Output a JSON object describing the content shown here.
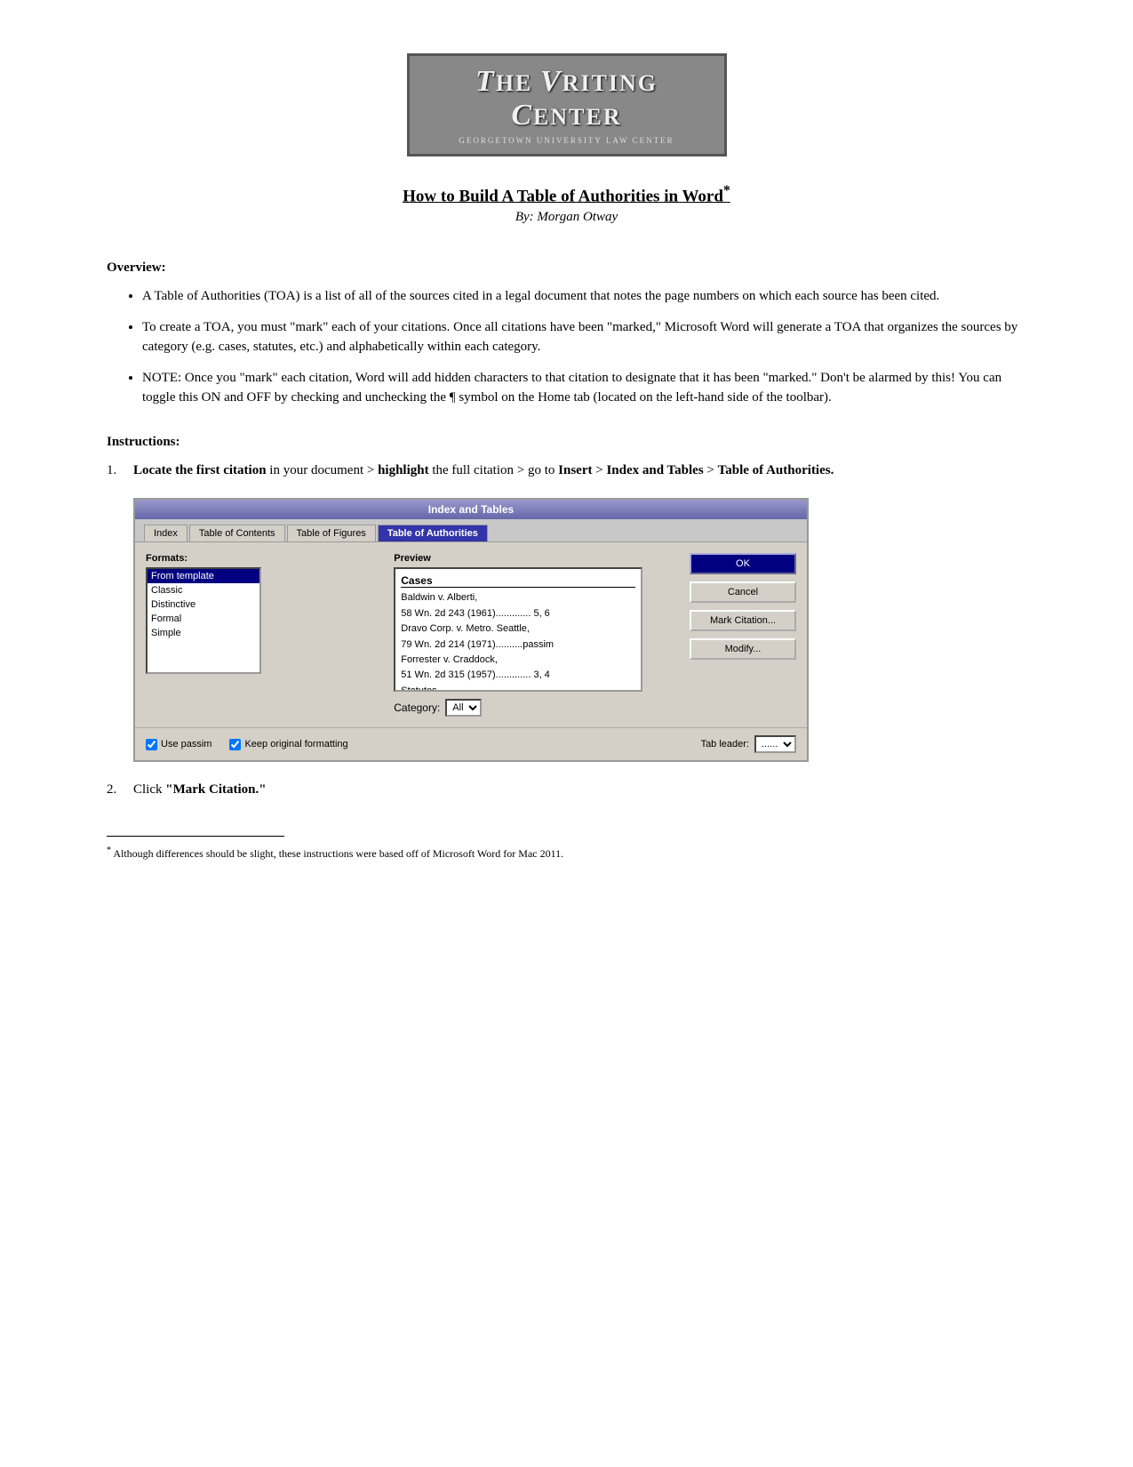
{
  "logo": {
    "title_prefix": "HE ",
    "title_v": "V",
    "title_riting": "RITING ",
    "title_c": "C",
    "title_enter": "ENTER",
    "subtitle": "GEORGETOWN UNIVERSITY LAW CENTER"
  },
  "header": {
    "title": "How to Build A Table of Authorities in Word",
    "title_asterisk": "*",
    "author": "By: Morgan Otway"
  },
  "overview": {
    "heading": "Overview:",
    "bullets": [
      "A Table of Authorities (TOA) is a list of all of the sources cited in a legal document that notes the page numbers on which each source has been cited.",
      "To create a TOA, you must \"mark\" each of your citations. Once all citations have been \"marked,\" Microsoft Word will generate a TOA that organizes the sources by category (e.g. cases, statutes, etc.) and alphabetically within each category.",
      "NOTE: Once you \"mark\" each citation, Word will add hidden characters to that citation to designate that it has been \"marked.\" Don't be alarmed by this! You can toggle this ON and OFF by checking and unchecking the ¶ symbol on the Home tab (located on the left-hand side of the toolbar)."
    ]
  },
  "instructions": {
    "heading": "Instructions:",
    "steps": [
      {
        "num": "1.",
        "text_parts": [
          {
            "text": "Locate the first citation",
            "bold": true
          },
          {
            "text": " in your document > "
          },
          {
            "text": "highlight",
            "bold": true
          },
          {
            "text": " the full citation > go to "
          },
          {
            "text": "Insert",
            "bold": true
          },
          {
            "text": " > "
          },
          {
            "text": "Index and Tables",
            "bold": true
          },
          {
            "text": " > "
          },
          {
            "text": "Table of Authorities.",
            "bold": true
          }
        ]
      },
      {
        "num": "2.",
        "text_parts": [
          {
            "text": "Click "
          },
          {
            "text": "\"Mark Citation.\"",
            "bold": true
          }
        ]
      }
    ]
  },
  "dialog": {
    "title": "Index and Tables",
    "tabs": [
      "Index",
      "Table of Contents",
      "Table of Figures",
      "Table of Authorities"
    ],
    "active_tab": "Table of Authorities",
    "formats_label": "Formats:",
    "formats": [
      "From template",
      "Classic",
      "Distinctive",
      "Formal",
      "Simple"
    ],
    "selected_format": "From template",
    "preview_label": "Preview",
    "preview_category": "Cases",
    "preview_entries": [
      "Baldwin v. Alberti,",
      "    58 Wn. 2d 243 (1961)............. 5, 6",
      "Dravo Corp. v. Metro. Seattle,",
      "    79 Wn. 2d 214 (1971)..........passim",
      "Forrester v. Craddock,",
      "    51 Wn. 2d 315 (1957)............. 3, 4",
      "Statutes"
    ],
    "buttons": [
      "OK",
      "Cancel",
      "Mark Citation...",
      "Modify..."
    ],
    "category_label": "Category:",
    "category_value": "All",
    "use_passim_label": "Use passim",
    "use_passim_checked": true,
    "keep_formatting_label": "Keep original formatting",
    "keep_formatting_checked": true,
    "tab_leader_label": "Tab leader:",
    "tab_leader_value": "......"
  },
  "footnote": {
    "symbol": "*",
    "text": "Although differences should be slight, these instructions were based off of Microsoft Word for Mac 2011."
  }
}
